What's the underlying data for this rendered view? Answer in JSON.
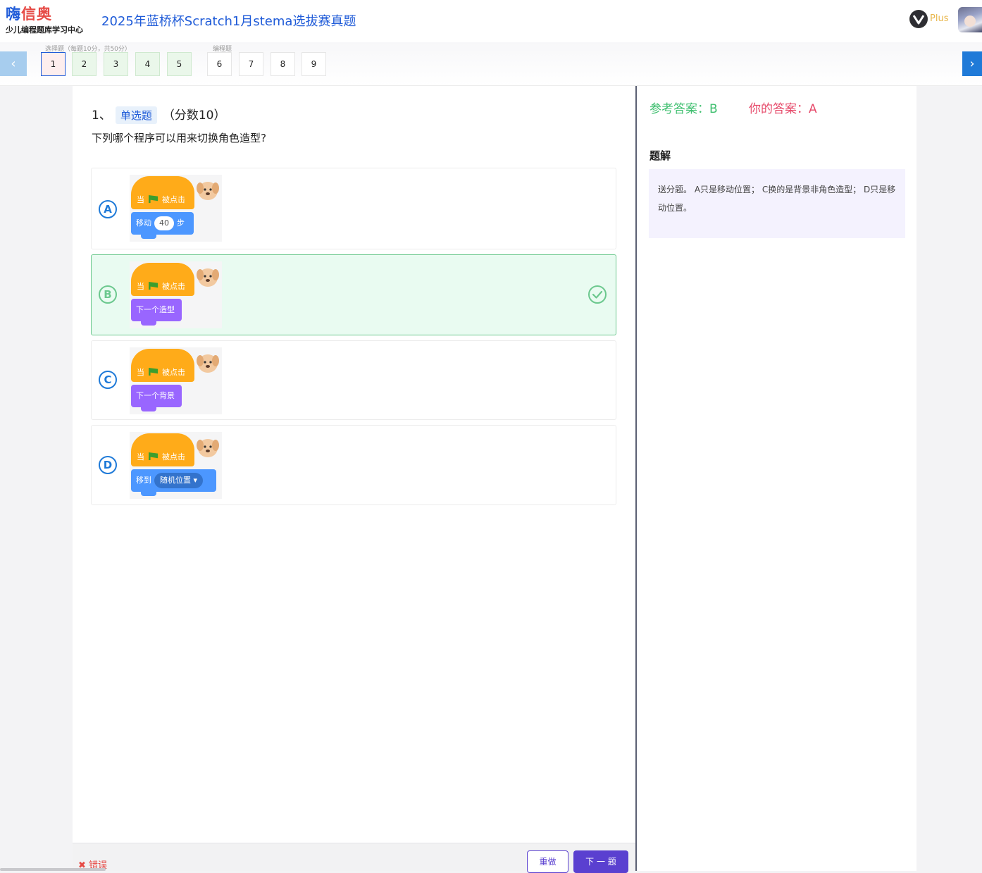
{
  "header": {
    "logo_part1": "嗨",
    "logo_part2": "信奥",
    "logo_sub": "少儿编程题库学习中心",
    "title": "2025年蓝桥杯Scratch1月stema选拔赛真题",
    "plus_label": "Plus"
  },
  "qnav": {
    "choice_group_label": "选择题（每题10分，共50分）",
    "program_group_label": "编程题",
    "choice_buttons": [
      "1",
      "2",
      "3",
      "4",
      "5"
    ],
    "program_buttons": [
      "6",
      "7",
      "8",
      "9"
    ],
    "current": "1",
    "prev_glyph": "‹",
    "next_glyph": "›"
  },
  "question": {
    "number": "1、",
    "type": "单选题",
    "score": "（分数10）",
    "text": "下列哪个程序可以用来切换角色造型?",
    "hat_when": "当",
    "hat_clicked": "被点击",
    "options": [
      {
        "letter": "A",
        "block_prefix": "移动",
        "block_value": "40",
        "block_suffix": "步"
      },
      {
        "letter": "B",
        "block_text": "下一个造型"
      },
      {
        "letter": "C",
        "block_text": "下一个背景"
      },
      {
        "letter": "D",
        "block_prefix": "移到",
        "block_dropdown": "随机位置 ▾"
      }
    ],
    "correct_option": "B"
  },
  "bottom": {
    "wrong_label": "✖ 错误",
    "redo_label": "重做",
    "next_label": "下 一 题"
  },
  "answer": {
    "reference": "参考答案：B",
    "yours": "你的答案：A",
    "solution_title": "题解",
    "solution_text": "送分题。 A只是移动位置；  C换的是背景非角色造型；  D只是移动位置。"
  },
  "colors": {
    "brand_blue": "#1f5bd8",
    "correct_green": "#3fbf6f",
    "wrong_red": "#e64a6a",
    "action_purple": "#5a40d0"
  }
}
